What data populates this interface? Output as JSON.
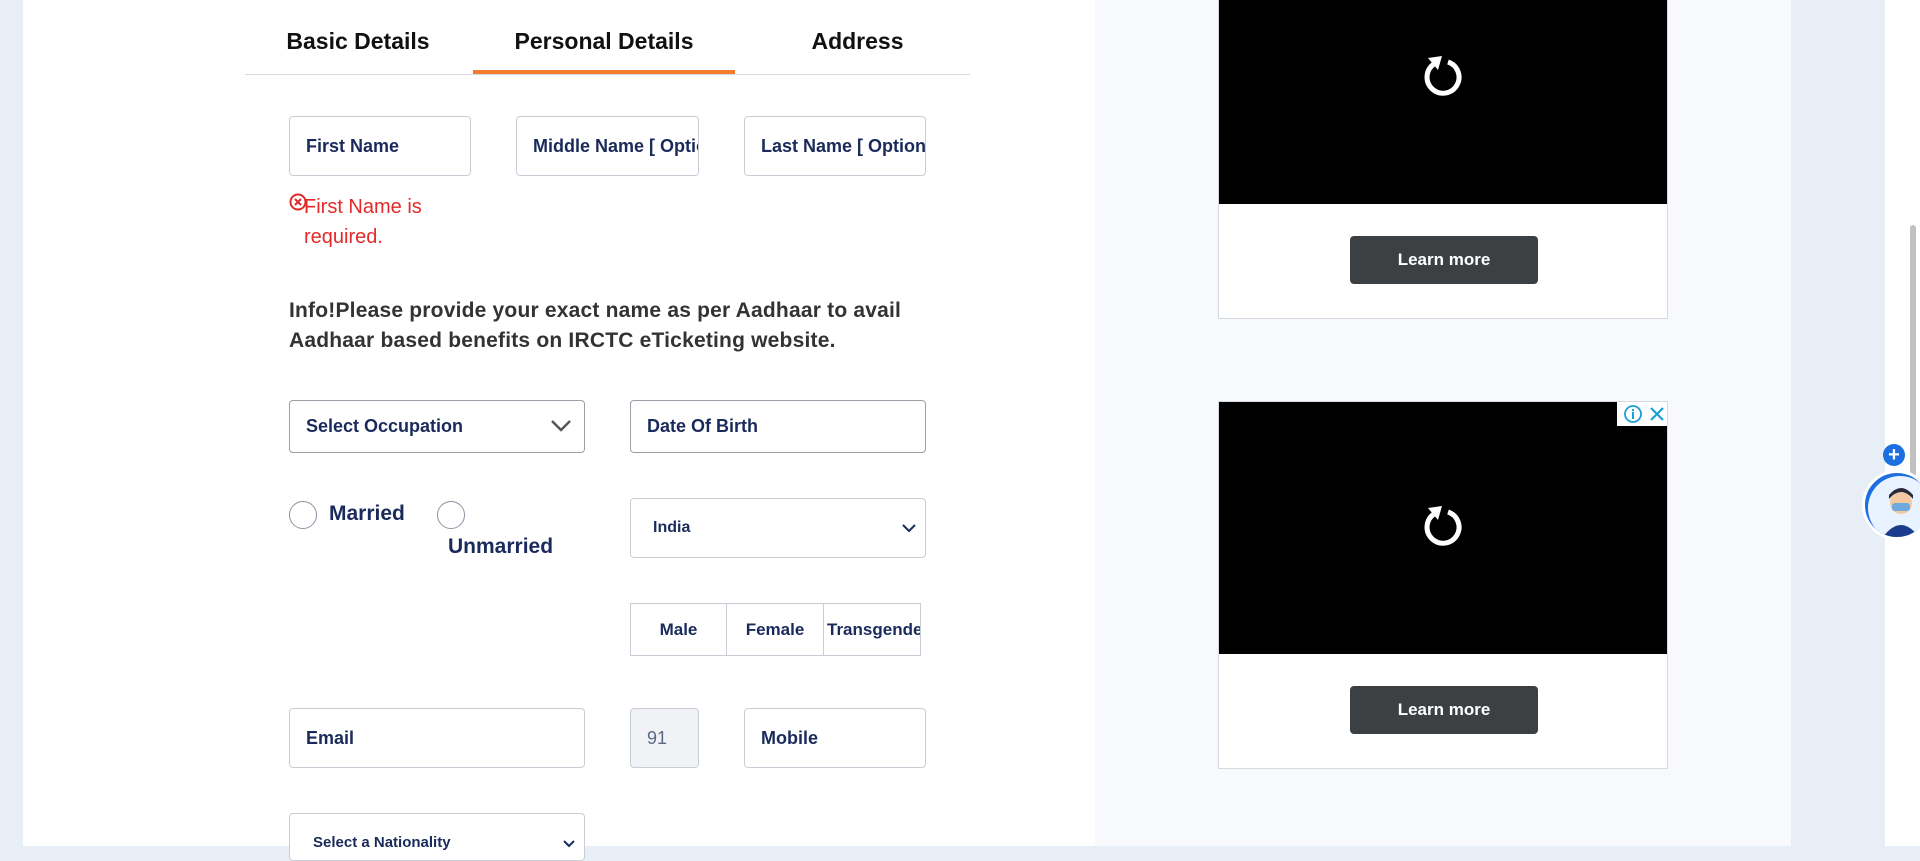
{
  "tabs": [
    {
      "label": "Basic Details"
    },
    {
      "label": "Personal Details"
    },
    {
      "label": "Address"
    }
  ],
  "form": {
    "first_name_placeholder": "First Name",
    "middle_name_placeholder": "Middle Name  [ Optional ]",
    "last_name_placeholder": "Last Name  [ Optional ]",
    "first_name_error": "First Name is required.",
    "info_text": "Info!Please provide your exact name as per Aadhaar to avail Aadhaar based benefits on IRCTC eTicketing website.",
    "occupation_placeholder": "Select Occupation",
    "dob_placeholder": "Date Of Birth",
    "marital": {
      "married": "Married",
      "unmarried": "Unmarried"
    },
    "country_value": "India",
    "gender": {
      "male": "Male",
      "female": "Female",
      "transgender": "Transgender"
    },
    "email_placeholder": "Email",
    "country_code": "91",
    "mobile_placeholder": "Mobile",
    "nationality_placeholder": "Select a Nationality"
  },
  "ads": [
    {
      "cta": "Learn more"
    },
    {
      "cta": "Learn more"
    }
  ],
  "colors": {
    "accent": "#f37b2b",
    "error": "#e32a2a",
    "label": "#1a2b5b",
    "ad_button": "#3c4043"
  }
}
